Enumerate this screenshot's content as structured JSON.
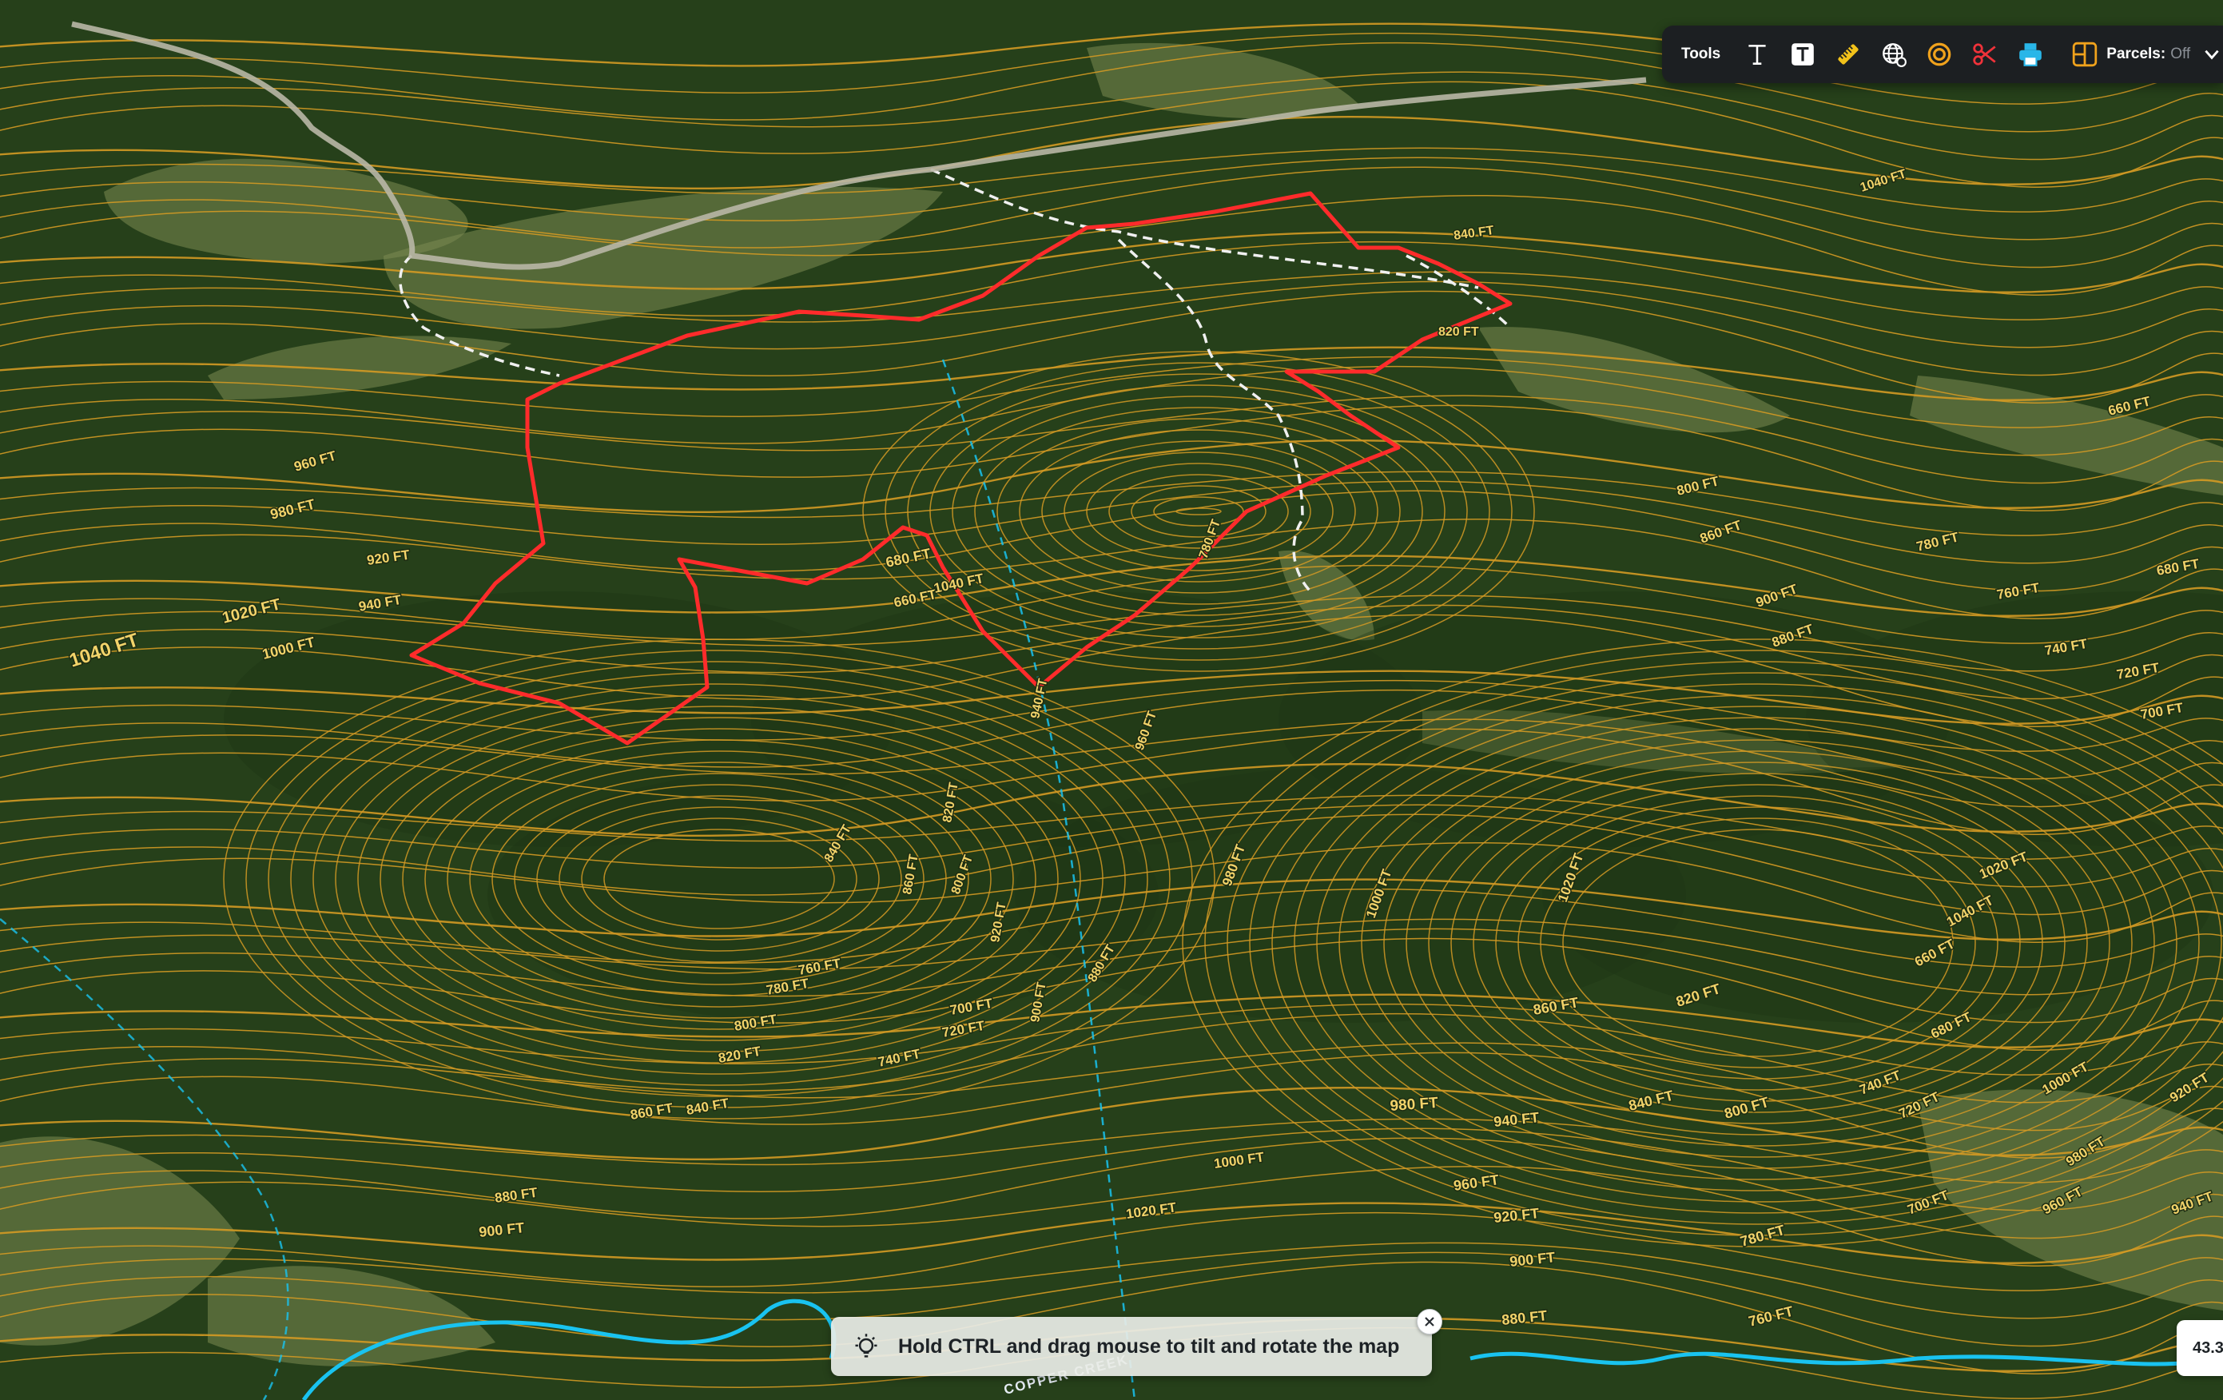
{
  "map": {
    "contour_labels": [
      "1040 FT",
      "1020 FT",
      "1000 FT",
      "980 FT",
      "960 FT",
      "940 FT",
      "920 FT",
      "900 FT",
      "880 FT",
      "860 FT",
      "840 FT",
      "820 FT",
      "800 FT",
      "780 FT",
      "760 FT",
      "740 FT",
      "720 FT",
      "700 FT",
      "680 FT",
      "660 FT"
    ],
    "road_label": "COPPER CREEK",
    "colors": {
      "contour": "#d49a24",
      "parcel_boundary": "#ff2b2b",
      "trail": "#f0f0f0",
      "stream": "#19c3f0",
      "terrain_dark": "#26401a",
      "terrain_light": "#7b8a52"
    }
  },
  "toolbar": {
    "tools_label": "Tools",
    "buttons": [
      {
        "name": "text-tool",
        "icon": "text-icon"
      },
      {
        "name": "text-box-tool",
        "icon": "text-box-icon"
      },
      {
        "name": "measure-tool",
        "icon": "ruler-icon"
      },
      {
        "name": "basemap-tool",
        "icon": "globe-icon"
      },
      {
        "name": "radius-tool",
        "icon": "radius-circle-icon"
      },
      {
        "name": "cut-tool",
        "icon": "scissors-icon"
      },
      {
        "name": "print-tool",
        "icon": "printer-icon"
      }
    ],
    "parcels_label": "Parcels:",
    "parcels_value": "Off"
  },
  "hint": {
    "text": "Hold CTRL and drag mouse to tilt and rotate the map"
  },
  "zoom": {
    "value": "43.3"
  }
}
